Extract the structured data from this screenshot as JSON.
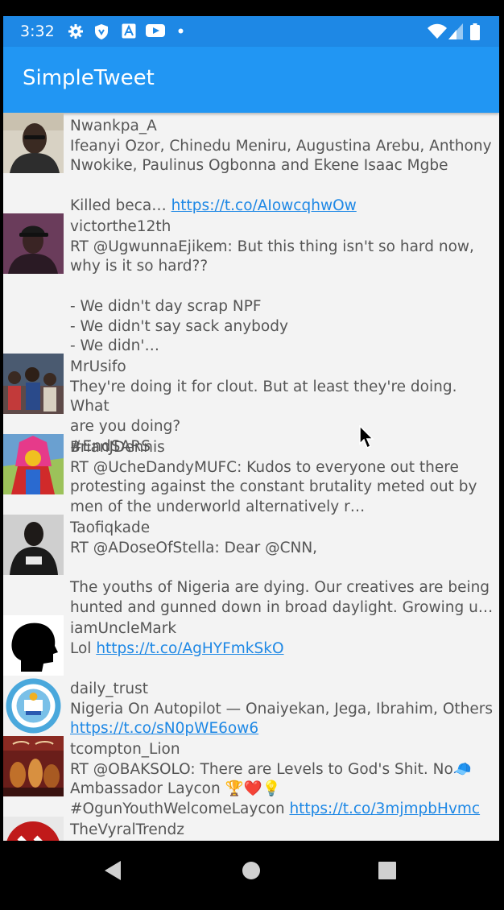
{
  "status_bar": {
    "time": "3:32",
    "icons": [
      "settings-icon",
      "shield-icon",
      "font-icon",
      "youtube-icon",
      "dot-icon",
      "wifi-icon",
      "signal-icon",
      "battery-icon"
    ]
  },
  "app_bar": {
    "title": "SimpleTweet"
  },
  "tweets": [
    {
      "username": "Nwankpa_A",
      "text": "Ifeanyi Ozor, Chinedu Meniru, Augustina Arebu, Anthony\nNwokike, Paulinus Ogbonna and Ekene Isaac Mgbe\n\nKilled beca… ",
      "link": "https://t.co/AIowcqhwOw",
      "avatar": "man-with-glasses"
    },
    {
      "username": "victorthe12th",
      "text": "RT @UgwunnaEjikem: But this thing isn't so hard now,\nwhy is it so hard??\n\n- We didn't day scrap NPF\n- We didn't say sack anybody\n- We didn'…",
      "link": "",
      "avatar": "man-in-cap"
    },
    {
      "username": "MrUsifo",
      "text": "They're doing it for clout. But at least they're doing. What\nare you doing?\n#EndSARS",
      "link": "",
      "avatar": "crowd-photo"
    },
    {
      "username": "BrianJDennis",
      "text": "RT @UcheDandyMUFC: Kudos to everyone out there\nprotesting against the constant brutality meted out by\nmen of the underworld alternatively r…",
      "link": "",
      "avatar": "masquerade-costume"
    },
    {
      "username": "Taofiqkade",
      "text": "RT @ADoseOfStella: Dear @CNN,\n\nThe youths of Nigeria are dying. Our creatives are being\nhunted and gunned down in broad daylight. Growing u…",
      "link": "",
      "avatar": "man-in-tshirt"
    },
    {
      "username": "iamUncleMark",
      "text": "Lol ",
      "link": "https://t.co/AgHYFmkSkO",
      "avatar": "head-silhouette"
    },
    {
      "username": "daily_trust",
      "text": "Nigeria On Autopilot — Onaiyekan, Jega, Ibrahim, Others\n",
      "link": "https://t.co/sN0pWE6ow6",
      "avatar": "circular-logo"
    },
    {
      "username": "tcompton_Lion",
      "text": "RT @OBAKSOLO: There are Levels to God's Shit. No🧢\nAmbassador Laycon 🏆❤️💡\n#OgunYouthWelcomeLaycon ",
      "link": "https://t.co/3mjmpbHvmc",
      "avatar": "carpe-diem-painting"
    },
    {
      "username": "TheVyralTrendz",
      "text": "",
      "link": "",
      "avatar": "red-logo"
    }
  ],
  "nav_bar": {
    "icons": [
      "back-icon",
      "home-icon",
      "recents-icon"
    ]
  },
  "colors": {
    "status_bar": "#1e88e5",
    "app_bar": "#2196f3",
    "link": "#1e88e5",
    "feed_bg": "#f3f3f3"
  }
}
